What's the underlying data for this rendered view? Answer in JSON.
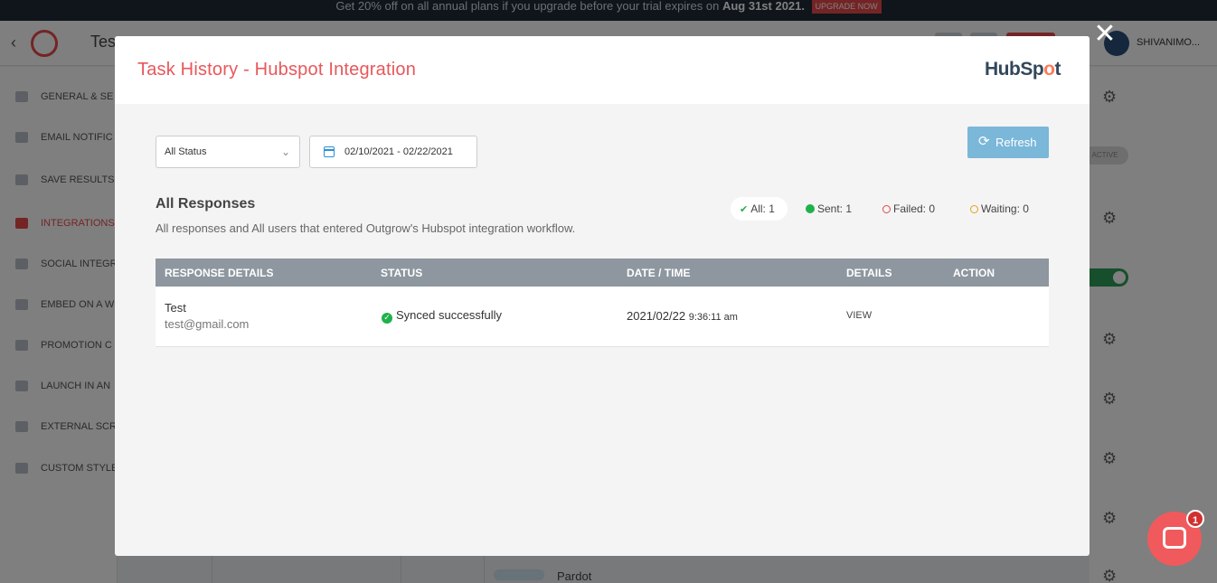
{
  "promo": {
    "text": "Get 20% off on all annual plans if you upgrade before your trial expires on",
    "date": "Aug 31st 2021.",
    "button": "UPGRADE NOW"
  },
  "app": {
    "title": "Tes",
    "user": "SHIVANIMO..."
  },
  "sidebar": {
    "items": [
      {
        "label": "GENERAL & SE",
        "icon": "settings-icon"
      },
      {
        "label": "EMAIL NOTIFIC",
        "icon": "email-icon"
      },
      {
        "label": "SAVE RESULTS",
        "icon": "pdf-icon"
      },
      {
        "label": "INTEGRATIONS",
        "icon": "grid-dots-icon"
      },
      {
        "label": "SOCIAL INTEGR",
        "icon": "users-icon"
      },
      {
        "label": "EMBED ON A W",
        "icon": "monitor-icon"
      },
      {
        "label": "PROMOTION C",
        "icon": "list-check-icon"
      },
      {
        "label": "LAUNCH IN AN",
        "icon": "inbox-icon"
      },
      {
        "label": "EXTERNAL SCR",
        "icon": "code-icon"
      },
      {
        "label": "CUSTOM STYLE",
        "icon": "style-icon"
      }
    ]
  },
  "background": {
    "inactive_pill": "ACTIVE",
    "pardot": "Pardot"
  },
  "modal": {
    "title": "Task History - Hubspot Integration",
    "logo": {
      "part1": "HubSp",
      "part2": "o",
      "part3": "t"
    },
    "status_select": {
      "value": "All Status"
    },
    "date_range": {
      "value": "02/10/2021 - 02/22/2021"
    },
    "refresh_label": "Refresh",
    "section_title": "All Responses",
    "section_sub": "All responses and All users that entered Outgrow's Hubspot integration workflow.",
    "stats": {
      "all": "All: 1",
      "sent": "Sent: 1",
      "failed": "Failed: 0",
      "waiting": "Waiting: 0"
    },
    "table": {
      "headers": [
        "RESPONSE DETAILS",
        "STATUS",
        "DATE / TIME",
        "DETAILS",
        "ACTION"
      ],
      "rows": [
        {
          "name": "Test",
          "email": "test@gmail.com",
          "status": "Synced successfully",
          "date": "2021/02/22",
          "time": "9:36:11 am",
          "details": "VIEW"
        }
      ]
    }
  },
  "chat": {
    "badge": "1"
  },
  "colors": {
    "accent": "#e8575a",
    "refresh": "#7ab7d9",
    "table_header": "#8e979f",
    "success": "#1fb24a",
    "hubspot_orange": "#ff7a59"
  }
}
